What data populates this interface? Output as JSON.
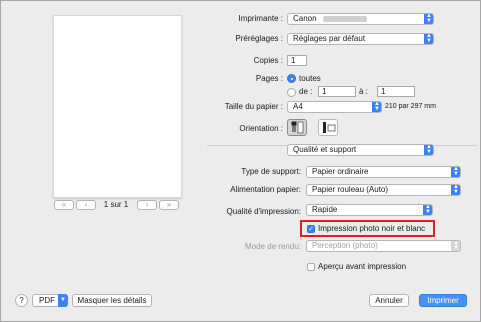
{
  "preview": {
    "page_counter": "1 sur 1",
    "first_icon": "double-chevron-left",
    "prev_icon": "chevron-left",
    "next_icon": "chevron-right",
    "last_icon": "double-chevron-right"
  },
  "printer": {
    "label": "Imprimante :",
    "value": "Canon",
    "blurred_suffix": "PRO-XXXX"
  },
  "presets": {
    "label": "Préréglages :",
    "value": "Réglages par défaut"
  },
  "copies": {
    "label": "Copies :",
    "value": "1"
  },
  "pages": {
    "label": "Pages :",
    "all_label": "toutes",
    "from_label": "de :",
    "from_value": "1",
    "to_label": "à :",
    "to_value": "1",
    "selected": "toutes"
  },
  "paper_size": {
    "label": "Taille du papier :",
    "value": "A4",
    "dimensions": "210 par 297 mm"
  },
  "orientation": {
    "label": "Orientation :",
    "selected": "portrait"
  },
  "section": {
    "value": "Qualité et support"
  },
  "media_type": {
    "label": "Type de support:",
    "value": "Papier ordinaire"
  },
  "paper_source": {
    "label": "Alimentation papier:",
    "value": "Papier rouleau (Auto)"
  },
  "print_quality": {
    "label": "Qualité d'impression:",
    "value": "Rapide"
  },
  "grayscale": {
    "label": "Impression photo noir et blanc",
    "checked": true
  },
  "render_mode": {
    "label": "Mode de rendu:",
    "value": "Perception (photo)",
    "enabled": false
  },
  "preview_before_print": {
    "label": "Aperçu avant impression",
    "checked": false
  },
  "footer": {
    "help": "?",
    "pdf": "PDF",
    "hide_details": "Masquer les détails",
    "cancel": "Annuler",
    "print": "Imprimer"
  },
  "colors": {
    "accent": "#3b82f6",
    "highlight_box": "#e02020"
  }
}
